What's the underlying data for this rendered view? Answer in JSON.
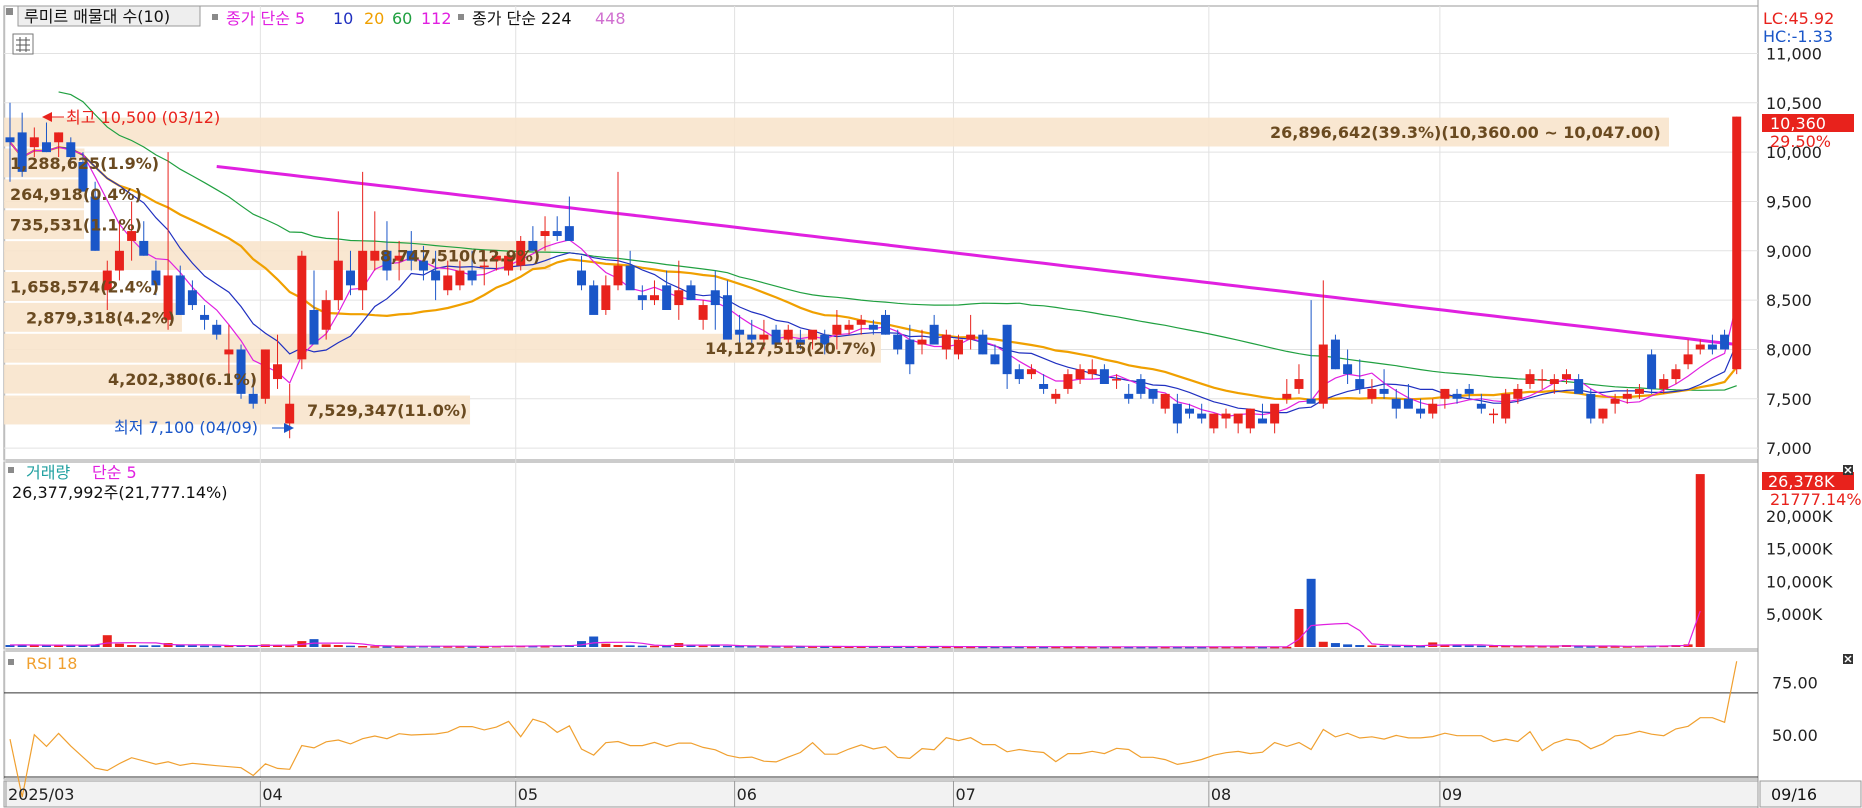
{
  "legend": {
    "volume_profile_label": "루미르 매물대 수(10)",
    "ma_label": "종가 단순 5",
    "ma_periods": [
      "10",
      "20",
      "60",
      "112"
    ],
    "ma2_label": "종가 단순 224",
    "ma2_period": "448"
  },
  "price_panel": {
    "lc": "LC:45.92",
    "hc": "HC:-1.33",
    "current_price": "10,360",
    "current_change": "29.50%",
    "high_note": "최고 10,500 (03/12)",
    "low_note": "최저 7,100 (04/09)",
    "y_ticks": [
      "11,000",
      "10,500",
      "10,000",
      "9,500",
      "9,000",
      "8,500",
      "8,000",
      "7,500",
      "7,000"
    ]
  },
  "volume_panel": {
    "title": "거래량",
    "ma_label": "단순 5",
    "readout": "26,377,992주(21,777.14%)",
    "current_value": "26,378K",
    "current_pct": "21777.14%",
    "y_ticks": [
      "20,000K",
      "15,000K",
      "10,000K",
      "5,000K"
    ]
  },
  "rsi_panel": {
    "title": "RSI 18",
    "y_ticks": [
      "75.00",
      "50.00"
    ]
  },
  "x_axis": {
    "labels": [
      "2025/03",
      "04",
      "05",
      "06",
      "07",
      "08",
      "09"
    ],
    "last_date": "09/16"
  },
  "colors": {
    "up": "#e8221c",
    "down": "#1a56c8",
    "ma5": "#e020e0",
    "ma10": "#2030c0",
    "ma20": "#f0a000",
    "ma60": "#20a040",
    "ma112": "#e020e0",
    "ma224": "#303030",
    "ma448": "#d070d0",
    "profile_fill": "#f8e4cc",
    "rsi": "#f0a030"
  },
  "chart_data": {
    "type": "candlestick",
    "ylim": [
      6900,
      11400
    ],
    "volume_profile": [
      {
        "label": "26,896,642(39.3%)(10,360.00 ~ 10,047.00)",
        "from": 10047,
        "to": 10360,
        "volume_pct": 39.3
      },
      {
        "label": "1,288,625(1.9%)",
        "from": 9734,
        "to": 10047,
        "volume_pct": 1.9
      },
      {
        "label": "264,918(0.4%)",
        "from": 9421,
        "to": 9734,
        "volume_pct": 0.4
      },
      {
        "label": "735,531(1.1%)",
        "from": 9108,
        "to": 9421,
        "volume_pct": 1.1
      },
      {
        "label": "8,747,510(12.9%)",
        "from": 8795,
        "to": 9108,
        "volume_pct": 12.9
      },
      {
        "label": "1,658,574(2.4%)",
        "from": 8482,
        "to": 8795,
        "volume_pct": 2.4
      },
      {
        "label": "2,879,318(4.2%)",
        "from": 8169,
        "to": 8482,
        "volume_pct": 4.2
      },
      {
        "label": "14,127,515(20.7%)",
        "from": 7856,
        "to": 8169,
        "volume_pct": 20.7
      },
      {
        "label": "4,202,380(6.1%)",
        "from": 7543,
        "to": 7856,
        "volume_pct": 6.1
      },
      {
        "label": "7,529,347(11.0%)",
        "from": 7230,
        "to": 7543,
        "volume_pct": 11.0
      }
    ],
    "month_starts": [
      0,
      21,
      42,
      60,
      78,
      99,
      118
    ],
    "ohlc": [
      [
        10150,
        10500,
        9700,
        10100
      ],
      [
        10200,
        10400,
        9750,
        9800
      ],
      [
        10050,
        10250,
        9950,
        10150
      ],
      [
        10100,
        10300,
        10000,
        10000
      ],
      [
        10100,
        10200,
        9950,
        10200
      ],
      [
        10100,
        10150,
        9900,
        9950
      ],
      [
        9900,
        10000,
        9600,
        9600
      ],
      [
        9550,
        9700,
        9000,
        9000
      ],
      [
        8600,
        8900,
        8400,
        8800
      ],
      [
        8800,
        9300,
        8700,
        9000
      ],
      [
        9100,
        9500,
        8900,
        9200
      ],
      [
        9100,
        9300,
        8950,
        8950
      ],
      [
        8800,
        8900,
        8550,
        8650
      ],
      [
        8300,
        10000,
        8200,
        8750
      ],
      [
        8750,
        8850,
        8350,
        8350
      ],
      [
        8600,
        8700,
        8400,
        8450
      ],
      [
        8350,
        8450,
        8200,
        8300
      ],
      [
        8250,
        8300,
        8100,
        8150
      ],
      [
        7950,
        8250,
        7700,
        8000
      ],
      [
        8000,
        8050,
        7500,
        7550
      ],
      [
        7550,
        7700,
        7400,
        7450
      ],
      [
        7500,
        8000,
        7450,
        8000
      ],
      [
        7700,
        8150,
        7600,
        7850
      ],
      [
        7250,
        7650,
        7100,
        7450
      ],
      [
        7900,
        9000,
        7800,
        8950
      ],
      [
        8400,
        8800,
        8100,
        8050
      ],
      [
        8200,
        8600,
        8100,
        8500
      ],
      [
        8500,
        9400,
        8400,
        8900
      ],
      [
        8800,
        9000,
        8550,
        8650
      ],
      [
        8600,
        9800,
        8400,
        9000
      ],
      [
        8900,
        9400,
        8800,
        9000
      ],
      [
        9000,
        9300,
        8700,
        8800
      ],
      [
        8900,
        9100,
        8700,
        8950
      ],
      [
        9000,
        9200,
        8800,
        8900
      ],
      [
        8900,
        9050,
        8700,
        8800
      ],
      [
        8800,
        9000,
        8500,
        8700
      ],
      [
        8600,
        8900,
        8550,
        8750
      ],
      [
        8650,
        8900,
        8600,
        8800
      ],
      [
        8800,
        9000,
        8650,
        8700
      ],
      [
        8850,
        9000,
        8650,
        8850
      ],
      [
        8900,
        9000,
        8800,
        8950
      ],
      [
        8800,
        9000,
        8750,
        8950
      ],
      [
        8850,
        9150,
        8800,
        9100
      ],
      [
        9100,
        9250,
        9000,
        9000
      ],
      [
        9150,
        9350,
        9000,
        9200
      ],
      [
        9200,
        9350,
        9100,
        9150
      ],
      [
        9250,
        9550,
        9100,
        9100
      ],
      [
        8800,
        8950,
        8600,
        8650
      ],
      [
        8650,
        8700,
        8400,
        8350
      ],
      [
        8400,
        8750,
        8350,
        8650
      ],
      [
        8650,
        9800,
        8600,
        8850
      ],
      [
        8850,
        9000,
        8650,
        8600
      ],
      [
        8550,
        8650,
        8400,
        8500
      ],
      [
        8500,
        8700,
        8450,
        8550
      ],
      [
        8650,
        8800,
        8500,
        8400
      ],
      [
        8450,
        8900,
        8300,
        8600
      ],
      [
        8650,
        8700,
        8500,
        8500
      ],
      [
        8300,
        8500,
        8200,
        8450
      ],
      [
        8600,
        8800,
        8200,
        8450
      ],
      [
        8550,
        8700,
        8400,
        8100
      ],
      [
        8200,
        8350,
        8000,
        8150
      ],
      [
        8150,
        8300,
        8050,
        8100
      ],
      [
        8100,
        8300,
        8000,
        8150
      ],
      [
        8200,
        8250,
        8100,
        8050
      ],
      [
        8100,
        8250,
        8050,
        8200
      ],
      [
        8100,
        8200,
        8000,
        8050
      ],
      [
        8100,
        8150,
        8000,
        8200
      ],
      [
        8150,
        8200,
        7950,
        8050
      ],
      [
        8150,
        8400,
        8000,
        8250
      ],
      [
        8200,
        8300,
        8150,
        8250
      ],
      [
        8250,
        8350,
        8150,
        8300
      ],
      [
        8250,
        8300,
        8150,
        8200
      ],
      [
        8350,
        8400,
        8150,
        8150
      ],
      [
        8150,
        8200,
        7950,
        8000
      ],
      [
        8100,
        8250,
        7750,
        7850
      ],
      [
        8050,
        8200,
        7950,
        8100
      ],
      [
        8250,
        8350,
        8050,
        8050
      ],
      [
        8000,
        8200,
        7900,
        8150
      ],
      [
        7950,
        8150,
        7900,
        8100
      ],
      [
        8100,
        8350,
        8000,
        8150
      ],
      [
        8150,
        8200,
        7950,
        7950
      ],
      [
        7950,
        8050,
        7850,
        7850
      ],
      [
        8250,
        8250,
        7600,
        7750
      ],
      [
        7800,
        7850,
        7650,
        7700
      ],
      [
        7750,
        7850,
        7700,
        7800
      ],
      [
        7650,
        7750,
        7550,
        7600
      ],
      [
        7500,
        7600,
        7450,
        7550
      ],
      [
        7600,
        7800,
        7550,
        7750
      ],
      [
        7700,
        7850,
        7650,
        7800
      ],
      [
        7750,
        7900,
        7700,
        7800
      ],
      [
        7800,
        7850,
        7650,
        7650
      ],
      [
        7700,
        7750,
        7600,
        7700
      ],
      [
        7550,
        7650,
        7450,
        7500
      ],
      [
        7700,
        7750,
        7500,
        7550
      ],
      [
        7600,
        7600,
        7450,
        7500
      ],
      [
        7400,
        7550,
        7350,
        7550
      ],
      [
        7450,
        7550,
        7150,
        7250
      ],
      [
        7400,
        7450,
        7300,
        7350
      ],
      [
        7350,
        7450,
        7250,
        7300
      ],
      [
        7200,
        7350,
        7150,
        7350
      ],
      [
        7300,
        7400,
        7200,
        7350
      ],
      [
        7250,
        7300,
        7150,
        7350
      ],
      [
        7200,
        7400,
        7150,
        7400
      ],
      [
        7300,
        7450,
        7250,
        7250
      ],
      [
        7250,
        7400,
        7150,
        7450
      ],
      [
        7500,
        7700,
        7450,
        7550
      ],
      [
        7600,
        7850,
        7550,
        7700
      ],
      [
        7500,
        8500,
        7500,
        7450
      ],
      [
        7450,
        8700,
        7400,
        8050
      ],
      [
        8100,
        8150,
        7800,
        7800
      ],
      [
        7850,
        8000,
        7650,
        7750
      ],
      [
        7700,
        7900,
        7550,
        7600
      ],
      [
        7500,
        7700,
        7450,
        7600
      ],
      [
        7600,
        7800,
        7500,
        7550
      ],
      [
        7500,
        7600,
        7300,
        7400
      ],
      [
        7500,
        7650,
        7450,
        7400
      ],
      [
        7400,
        7500,
        7300,
        7350
      ],
      [
        7350,
        7500,
        7300,
        7450
      ],
      [
        7500,
        7600,
        7400,
        7600
      ],
      [
        7550,
        7600,
        7450,
        7500
      ],
      [
        7600,
        7650,
        7500,
        7550
      ],
      [
        7450,
        7550,
        7350,
        7400
      ],
      [
        7350,
        7400,
        7250,
        7350
      ],
      [
        7300,
        7600,
        7250,
        7550
      ],
      [
        7500,
        7650,
        7450,
        7600
      ],
      [
        7650,
        7800,
        7600,
        7750
      ],
      [
        7700,
        7800,
        7600,
        7700
      ],
      [
        7650,
        7750,
        7550,
        7700
      ],
      [
        7700,
        7800,
        7650,
        7750
      ],
      [
        7700,
        7750,
        7600,
        7550
      ],
      [
        7550,
        7600,
        7250,
        7300
      ],
      [
        7300,
        7400,
        7250,
        7400
      ],
      [
        7450,
        7550,
        7350,
        7500
      ],
      [
        7500,
        7600,
        7450,
        7550
      ],
      [
        7550,
        7650,
        7500,
        7600
      ],
      [
        7950,
        8000,
        7550,
        7600
      ],
      [
        7600,
        7750,
        7550,
        7700
      ],
      [
        7700,
        7850,
        7650,
        7800
      ],
      [
        7850,
        8100,
        7800,
        7950
      ],
      [
        8000,
        8100,
        7950,
        8050
      ],
      [
        8050,
        8150,
        7950,
        8000
      ],
      [
        8150,
        8200,
        8000,
        8000
      ],
      [
        7800,
        10360,
        7750,
        10360
      ]
    ],
    "volume": [
      300,
      350,
      250,
      280,
      300,
      260,
      320,
      350,
      1800,
      500,
      300,
      250,
      260,
      600,
      300,
      250,
      200,
      180,
      200,
      250,
      220,
      400,
      300,
      200,
      900,
      1200,
      400,
      300,
      200,
      150,
      120,
      100,
      100,
      120,
      150,
      130,
      120,
      110,
      100,
      90,
      150,
      200,
      180,
      160,
      140,
      200,
      300,
      900,
      1600,
      500,
      300,
      250,
      200,
      180,
      160,
      600,
      300,
      200,
      250,
      180,
      150,
      140,
      130,
      120,
      110,
      100,
      90,
      80,
      70,
      75,
      80,
      90,
      85,
      80,
      75,
      70,
      65,
      60,
      55,
      50,
      50,
      48,
      45,
      45,
      42,
      40,
      38,
      36,
      35,
      35,
      34,
      33,
      32,
      30,
      30,
      30,
      30,
      30,
      30,
      30,
      30,
      30,
      30,
      30,
      30,
      30,
      5800,
      10400,
      800,
      600,
      400,
      300,
      250,
      220,
      200,
      180,
      160,
      700,
      300,
      250,
      220,
      200,
      180,
      170,
      160,
      150,
      140,
      130,
      300,
      120,
      110,
      100,
      110,
      120,
      150,
      180,
      200,
      300,
      400,
      26378
    ]
  }
}
